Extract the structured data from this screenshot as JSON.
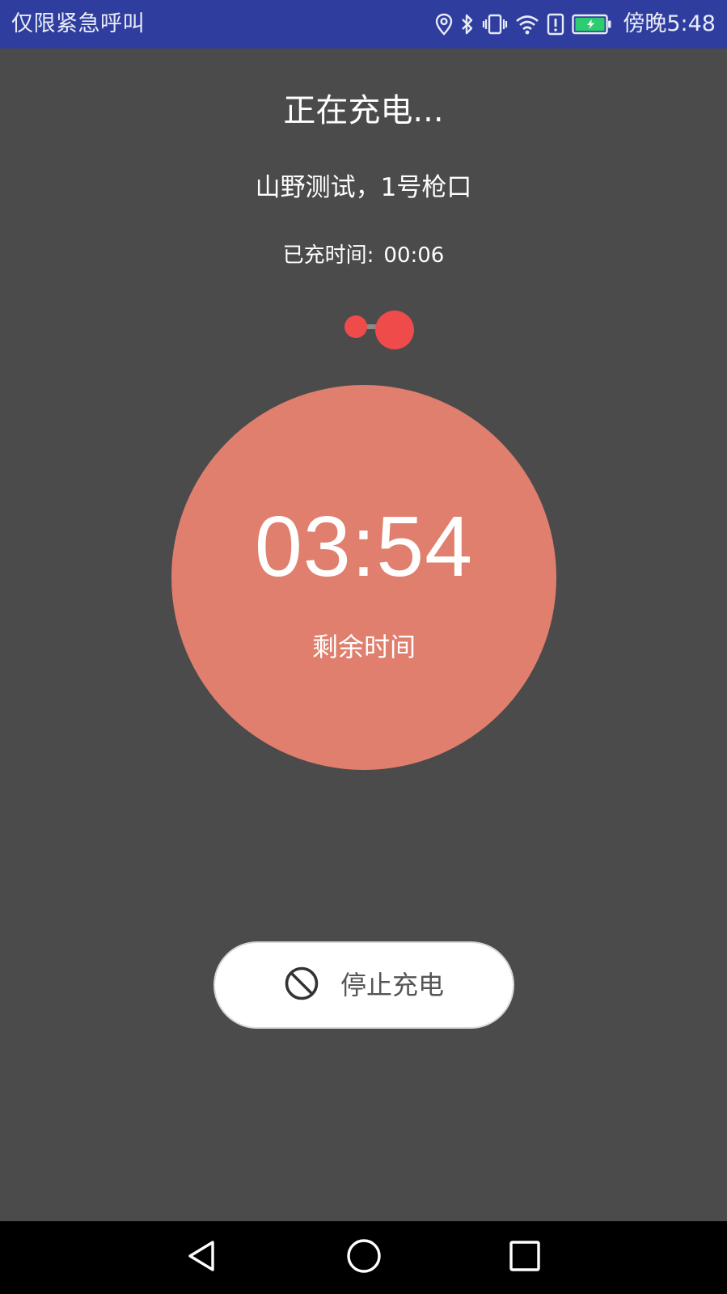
{
  "status_bar": {
    "carrier": "仅限紧急呼叫",
    "time": "傍晚5:48",
    "icons": [
      "location-icon",
      "bluetooth-icon",
      "vibrate-icon",
      "wifi-icon",
      "alert-icon",
      "battery-icon"
    ],
    "background_color": "#2f3e9e",
    "battery_color": "#2ecc71"
  },
  "charging": {
    "title": "正在充电...",
    "station": "山野测试，1号枪口",
    "elapsed_label": "已充时间:",
    "elapsed_value": "00:06",
    "loader_color": "#f04b4b"
  },
  "timer": {
    "value": "03:54",
    "label": "剩余时间",
    "circle_color": "#e07f6d"
  },
  "stop_button": {
    "icon": "stop-icon",
    "label": "停止充电"
  },
  "nav_bar": {
    "buttons": [
      "back-icon",
      "home-icon",
      "recents-icon"
    ]
  },
  "colors": {
    "background": "#4b4b4b"
  }
}
